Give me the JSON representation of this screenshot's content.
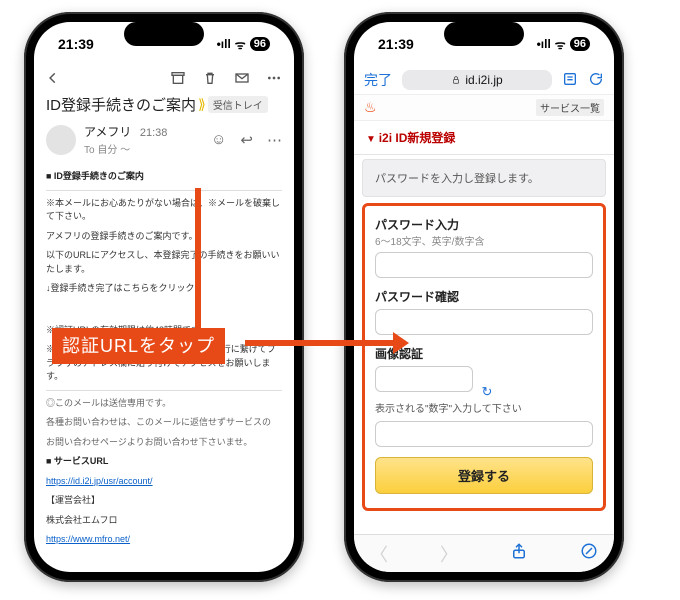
{
  "status": {
    "time": "21:39",
    "signal": "•ıll",
    "wifi": "ᯤ",
    "battery": "96"
  },
  "email": {
    "subject": "ID登録手続きのご案内",
    "label_inbox": "受信トレイ",
    "sender_name": "アメフリ",
    "sender_time": "21:38",
    "sender_to_line": "To 自分 〜",
    "body": {
      "heading": "■ ID登録手続きのご案内",
      "warn": "※本メールにお心あたりがない場合は、※メールを破棄して下さい。",
      "line1": "アメフリの登録手続きのご案内です。",
      "line2": "以下のURLにアクセスし、本登録完了の手続きをお願いいたします。",
      "click_prompt": "↓登録手続き完了はこちらをクリック↓",
      "note1": "※認証URLの有効期限は約48時間です。",
      "note2": "※認証URLの表示が折り返している場合は1行に繋げてブラウザのアドレス欄に貼り付けてアクセスをお願いします。",
      "sender_note1": "◎このメールは送信専用です。",
      "sender_note2": "各種お問い合わせは、このメールに返信せずサービスの",
      "sender_note3": "お問い合わせページよりお問い合わせ下さいませ。",
      "service_url_label": "■ サービスURL",
      "service_url": "https://id.i2i.jp/usr/account/",
      "company_label": "【運営会社】",
      "company_name": "株式会社エムフロ",
      "company_url": "https://www.mfro.net/"
    }
  },
  "browser": {
    "done": "完了",
    "address": "id.i2i.jp",
    "service_list": "サービス一覧",
    "breadcrumb": "i2i ID新規登録",
    "desc": "パスワードを入力し登録します。",
    "field_password_label": "パスワード入力",
    "field_password_sub": "6〜18文字、英字/数字含",
    "field_confirm_label": "パスワード確認",
    "field_captcha_label": "画像認証",
    "captcha_note": "表示される\"数字\"入力して下さい",
    "register_btn": "登録する"
  },
  "callout": {
    "text": "認証URLをタップ"
  }
}
